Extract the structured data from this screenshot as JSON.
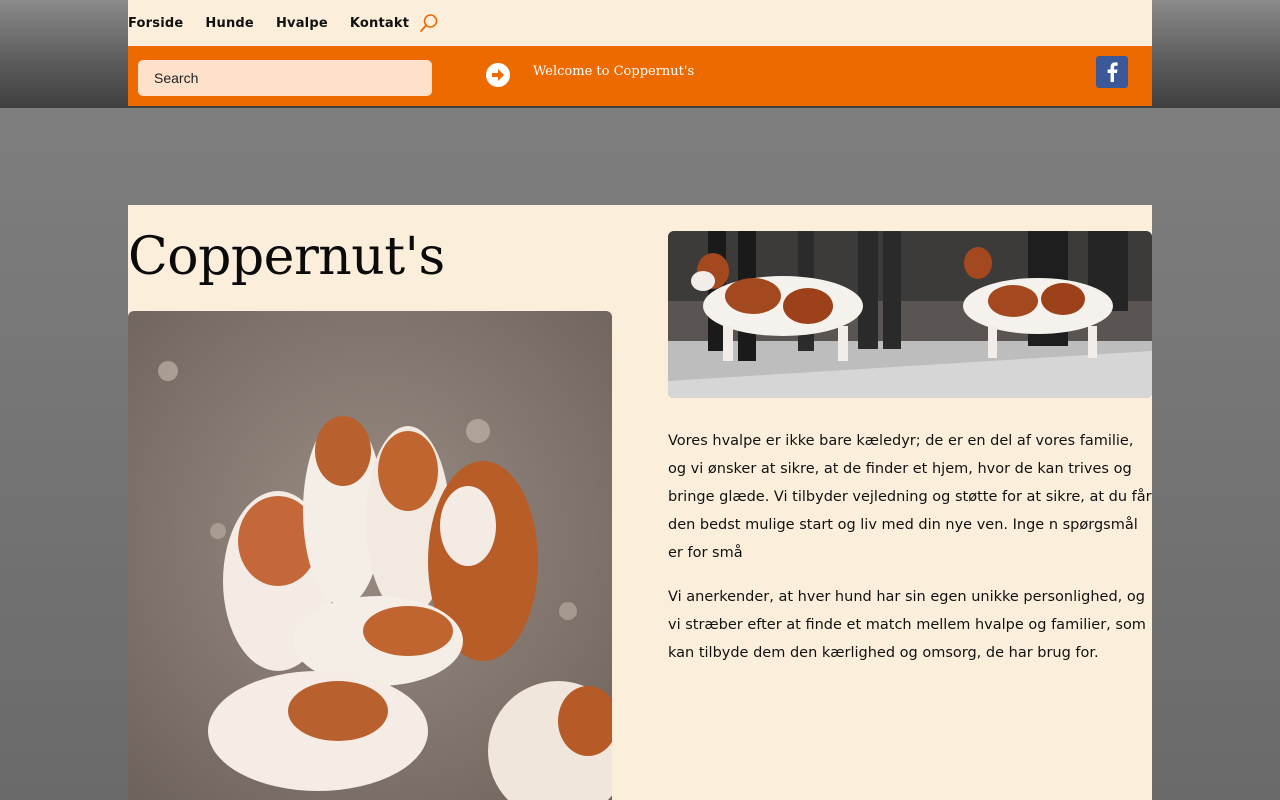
{
  "nav": {
    "items": [
      "Forside",
      "Hunde",
      "Hvalpe",
      "Kontakt"
    ]
  },
  "header": {
    "search_placeholder": "Search",
    "welcome": "Welcome to Coppernut's",
    "facebook_icon": "facebook-icon",
    "arrow_icon": "arrow-right-circle-icon"
  },
  "main": {
    "title": "Coppernut's",
    "paragraphs": [
      "Vores hvalpe er ikke bare kæledyr; de er en del af vores familie, og vi ønsker at sikre, at de finder et hjem, hvor de kan trives og bringe glæde. Vi tilbyder vejledning og støtte for at sikre, at du får den bedst mulige start og liv med din nye ven.  Inge n spørgsmål er for små",
      "Vi anerkender, at hver hund har sin egen unikke personlighed, og vi stræber efter at finde et match mellem hvalpe og familier, som kan tilbyde dem den kærlighed og omsorg, de har brug for."
    ]
  },
  "colors": {
    "accent": "#ec6a00",
    "cream": "#fbefdc",
    "facebook": "#3b5998"
  }
}
